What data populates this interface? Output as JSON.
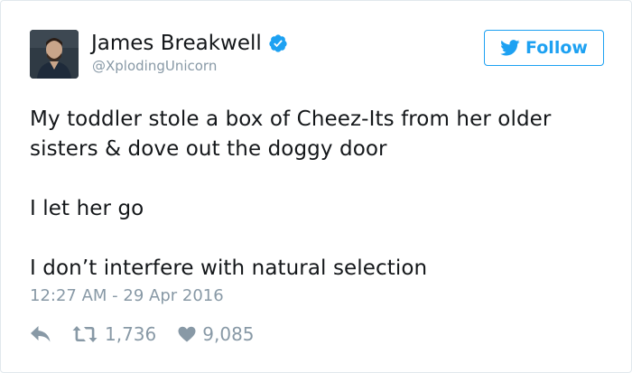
{
  "profile": {
    "name": "James Breakwell",
    "handle": "@XplodingUnicorn",
    "verified": true
  },
  "follow_button": {
    "label": "Follow",
    "color": "#1da1f2"
  },
  "tweet": {
    "lines": [
      "My toddler stole a box of Cheez-Its from her older",
      "sisters & dove out the doggy door",
      "I let her go",
      "I don’t interfere with natural selection"
    ],
    "timestamp": "12:27 AM - 29 Apr 2016"
  },
  "actions": {
    "reply_icon": "reply-icon",
    "retweet_icon": "retweet-icon",
    "retweet_count": "1,736",
    "like_icon": "heart-icon",
    "like_count": "9,085"
  },
  "colors": {
    "text": "#14171a",
    "muted": "#8899a6",
    "accent": "#1da1f2",
    "border": "#e1e8ed"
  }
}
